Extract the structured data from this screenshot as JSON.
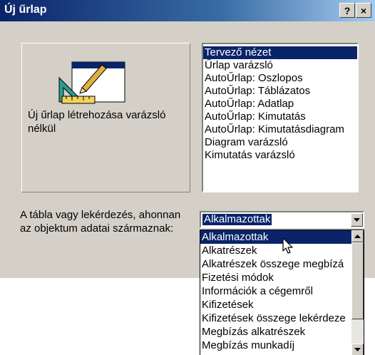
{
  "window": {
    "title": "Új űrlap",
    "help_label": "?",
    "close_label": "×"
  },
  "preview": {
    "caption": "Új űrlap létrehozása varázsló nélkül"
  },
  "method_list": {
    "items": [
      "Tervező nézet",
      "Űrlap varázsló",
      "AutoŰrlap: Oszlopos",
      "AutoŰrlap: Táblázatos",
      "AutoŰrlap: Adatlap",
      "AutoŰrlap:  Kimutatás",
      "AutoŰrlap:  Kimutatásdiagram",
      "Diagram varázsló",
      "Kimutatás varázsló"
    ],
    "selected_index": 0
  },
  "source": {
    "label": "A tábla vagy lekérdezés, ahonnan az objektum adatai származnak:",
    "combo_value": "Alkalmazottak",
    "dropdown_items": [
      "Alkalmazottak",
      "Alkatrészek",
      "Alkatrészek összege megbízá",
      "Fizetési módok",
      "Információk a cégemről",
      "Kifizetések",
      "Kifizetések összege lekérdeze",
      "Megbízás alkatrészek",
      "Megbízás munkadíj"
    ],
    "selected_index": 0
  },
  "icons": {
    "wizard": "form-design-icon",
    "dropdown_arrow": "chevron-down-icon",
    "scroll_up": "chevron-up-icon",
    "scroll_down": "chevron-down-icon",
    "cursor": "mouse-pointer-icon"
  },
  "colors": {
    "title_bar": "#0a246a",
    "dialog_face": "#d4d0c8",
    "selection": "#0a246a"
  }
}
